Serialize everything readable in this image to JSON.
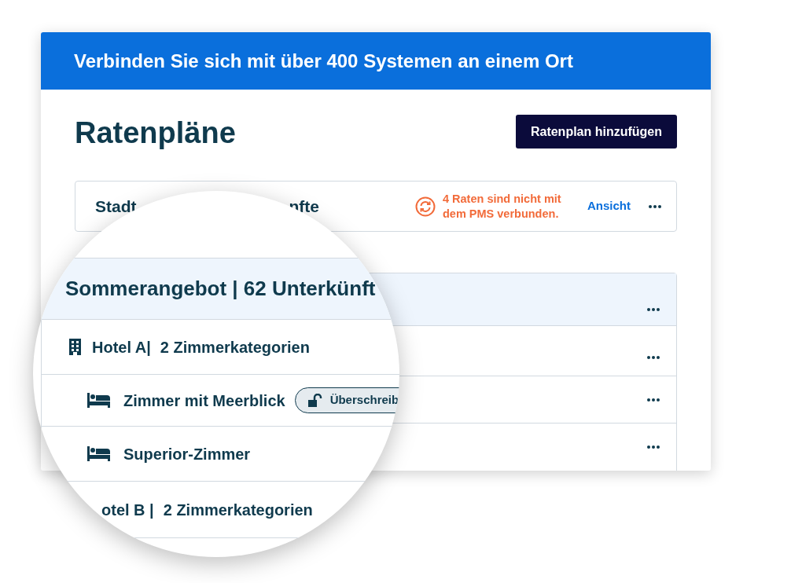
{
  "banner": {
    "title": "Verbinden Sie sich mit über 400 Systemen an einem Ort"
  },
  "page": {
    "title": "Ratenpläne",
    "add_button": "Ratenplan hinzufügen"
  },
  "rate_plan": {
    "title_start": "Stadt",
    "title_end": "nfte",
    "warning": "4 Raten sind nicht mit dem PMS verbunden.",
    "action": "Ansicht"
  },
  "magnifier": {
    "group_title": "Sommerangebot | 62 Unterkünft",
    "rows": [
      {
        "kind": "hotel",
        "name": "Hotel A|",
        "count": "2 Zimmerkategorien"
      },
      {
        "kind": "room",
        "name": "Zimmer mit Meerblick",
        "badge": "Überschreib"
      },
      {
        "kind": "room",
        "name": "Superior-Zimmer"
      },
      {
        "kind": "hotel",
        "name": "otel B |",
        "count": "2 Zimmerkategorien"
      }
    ]
  }
}
